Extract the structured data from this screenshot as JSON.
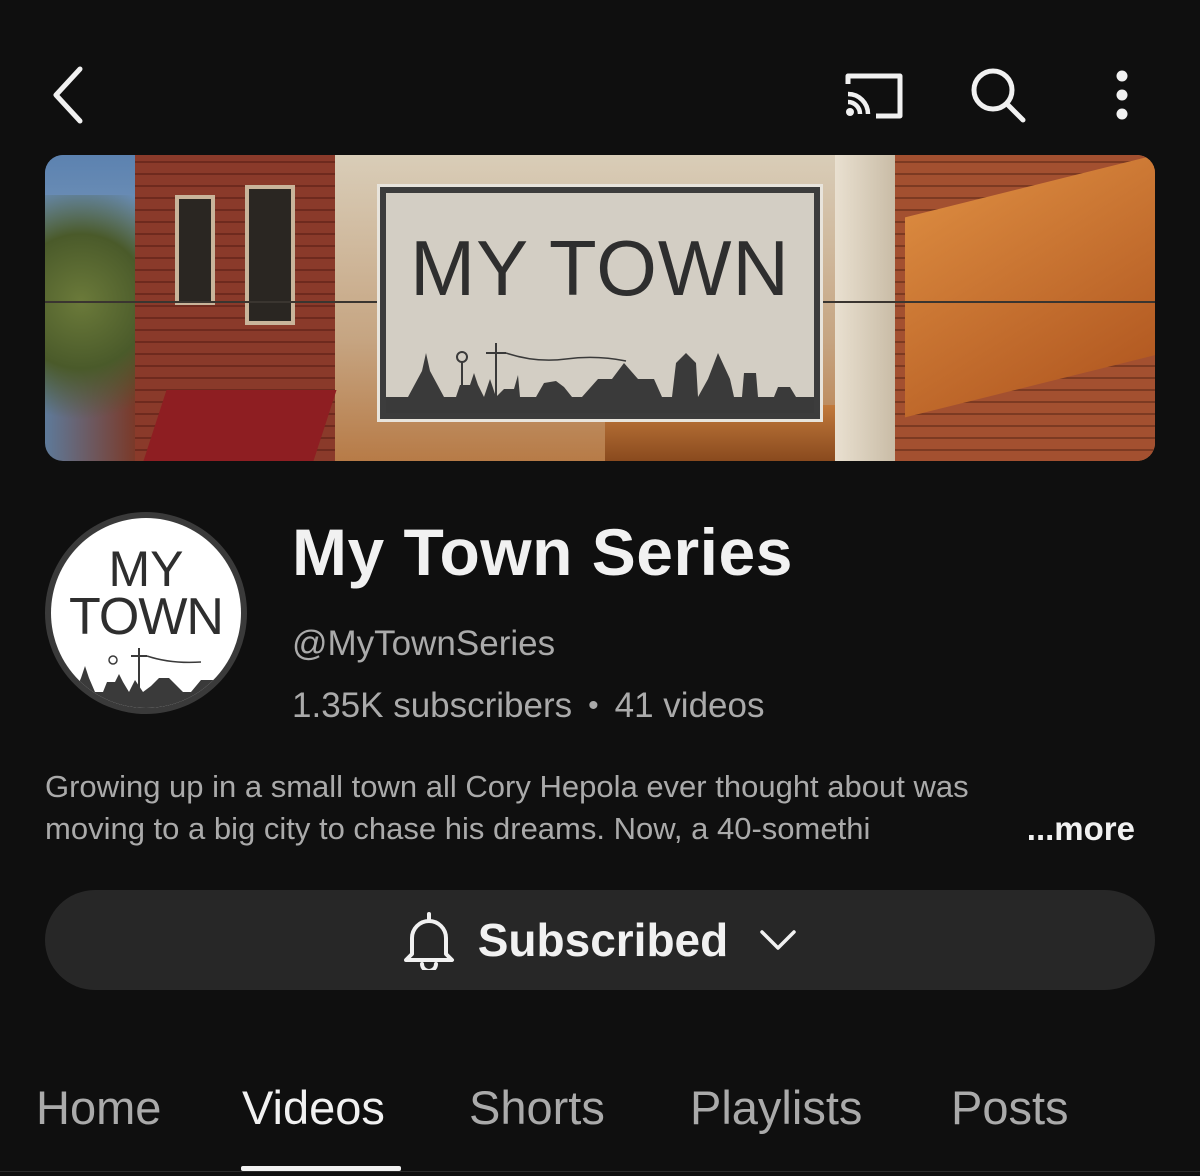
{
  "top_bar": {
    "back_icon": "chevron-left-icon",
    "cast_icon": "cast-icon",
    "search_icon": "search-icon",
    "more_icon": "more-vert-icon"
  },
  "banner": {
    "sign_text": "MY TOWN"
  },
  "channel": {
    "avatar_line1": "MY",
    "avatar_line2": "TOWN",
    "name": "My Town Series",
    "handle": "@MyTownSeries",
    "subscribers": "1.35K subscribers",
    "separator": "•",
    "videos": "41 videos",
    "description_line1": "Growing up in a small town all Cory Hepola ever thought about was",
    "description_line2": "moving to a big city to chase his dreams. Now, a 40-somethi",
    "more_label": "...more"
  },
  "subscribe_button": {
    "label": "Subscribed",
    "bell_icon": "bell-icon",
    "chevron_icon": "chevron-down-icon"
  },
  "tabs": [
    {
      "label": "Home",
      "active": false
    },
    {
      "label": "Videos",
      "active": true
    },
    {
      "label": "Shorts",
      "active": false
    },
    {
      "label": "Playlists",
      "active": false
    },
    {
      "label": "Posts",
      "active": false
    }
  ],
  "colors": {
    "background": "#0f0f0f",
    "text_primary": "#f1f1f1",
    "text_secondary": "#aaaaaa",
    "button_bg": "#272727"
  }
}
